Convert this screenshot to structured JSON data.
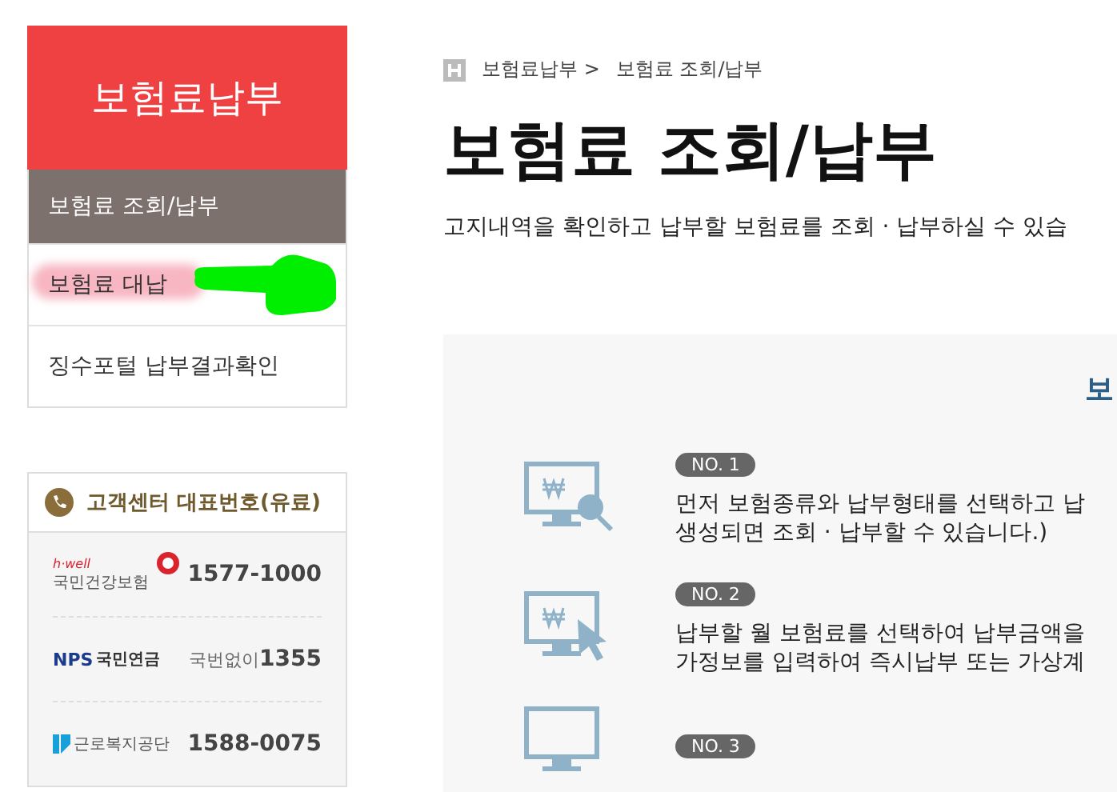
{
  "sidebar": {
    "title": "보험료납부",
    "items": [
      {
        "label": "보험료 조회/납부",
        "selected": true,
        "highlighted": false
      },
      {
        "label": "보험료 대납",
        "selected": false,
        "highlighted": true
      },
      {
        "label": "징수포털 납부결과확인",
        "selected": false,
        "highlighted": false
      }
    ]
  },
  "contact": {
    "title": "고객센터 대표번호(유료)",
    "rows": [
      {
        "kind": "nhis",
        "logo_tag": "h·well",
        "logo_text": "국민건강보험",
        "number": "1577-1000"
      },
      {
        "kind": "nps",
        "logo_tag": "NPS",
        "logo_text": "국민연금",
        "prefix": "국번없이",
        "number": "1355"
      },
      {
        "kind": "kcomwel",
        "logo_text": "근로복지공단",
        "number": "1588-0075"
      }
    ]
  },
  "breadcrumb": [
    "보험료납부 >",
    "보험료 조회/납부"
  ],
  "page_title": "보험료 조회/납부",
  "description": "고지내역을 확인하고 납부할 보험료를 조회 · 납부하실 수 있습",
  "panel": {
    "heading": "보",
    "steps": [
      {
        "badge": "NO. 1",
        "kind": "search",
        "lines": [
          "먼저 보험종류와 납부형태를 선택하고 납",
          "생성되면 조회 · 납부할 수 있습니다.)"
        ]
      },
      {
        "badge": "NO. 2",
        "kind": "pointer",
        "lines": [
          "납부할 월 보험료를 선택하여 납부금액을",
          "가정보를 입력하여 즉시납부 또는 가상계"
        ]
      },
      {
        "badge": "NO. 3",
        "kind": "plain"
      }
    ]
  }
}
